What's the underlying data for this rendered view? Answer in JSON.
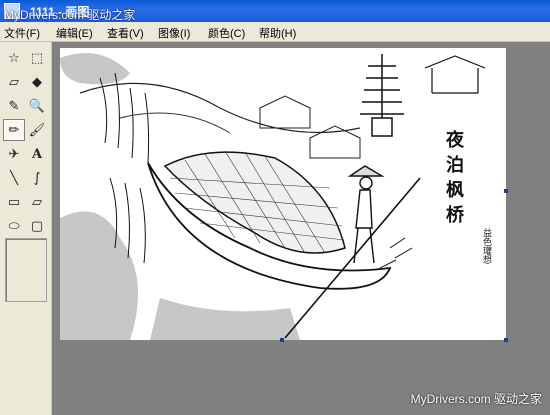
{
  "window": {
    "title": "1111 - 画图",
    "watermark": "MyDrivers.com 驱动之家"
  },
  "menu": [
    {
      "label": "文件(F)"
    },
    {
      "label": "编辑(E)"
    },
    {
      "label": "查看(V)"
    },
    {
      "label": "图像(I)"
    },
    {
      "label": "颜色(C)"
    },
    {
      "label": "帮助(H)"
    }
  ],
  "tools": [
    {
      "icon": "free-select-icon",
      "glyph": "☆"
    },
    {
      "icon": "rect-select-icon",
      "glyph": "⬚"
    },
    {
      "icon": "eraser-icon",
      "glyph": "▱"
    },
    {
      "icon": "fill-bucket-icon",
      "glyph": "◆"
    },
    {
      "icon": "eyedropper-icon",
      "glyph": "✎"
    },
    {
      "icon": "magnifier-icon",
      "glyph": "🔍"
    },
    {
      "icon": "pencil-icon",
      "glyph": "✏"
    },
    {
      "icon": "brush-icon",
      "glyph": "🖌"
    },
    {
      "icon": "airbrush-icon",
      "glyph": "✈"
    },
    {
      "icon": "text-icon",
      "glyph": "A"
    },
    {
      "icon": "line-icon",
      "glyph": "╲"
    },
    {
      "icon": "curve-icon",
      "glyph": "∫"
    },
    {
      "icon": "rectangle-icon",
      "glyph": "▭"
    },
    {
      "icon": "polygon-icon",
      "glyph": "▱"
    },
    {
      "icon": "ellipse-icon",
      "glyph": "⬭"
    },
    {
      "icon": "rounded-rect-icon",
      "glyph": "▢"
    }
  ],
  "canvas": {
    "poem_chars": [
      "夜",
      "泊",
      "枫",
      "桥"
    ],
    "signature": "益色瓘想"
  },
  "footer": {
    "watermark": "MyDrivers.com 驱动之家"
  },
  "colors": {
    "titlebar": "#1b5fd7",
    "chrome": "#ece9d8",
    "workspace": "#808080"
  }
}
